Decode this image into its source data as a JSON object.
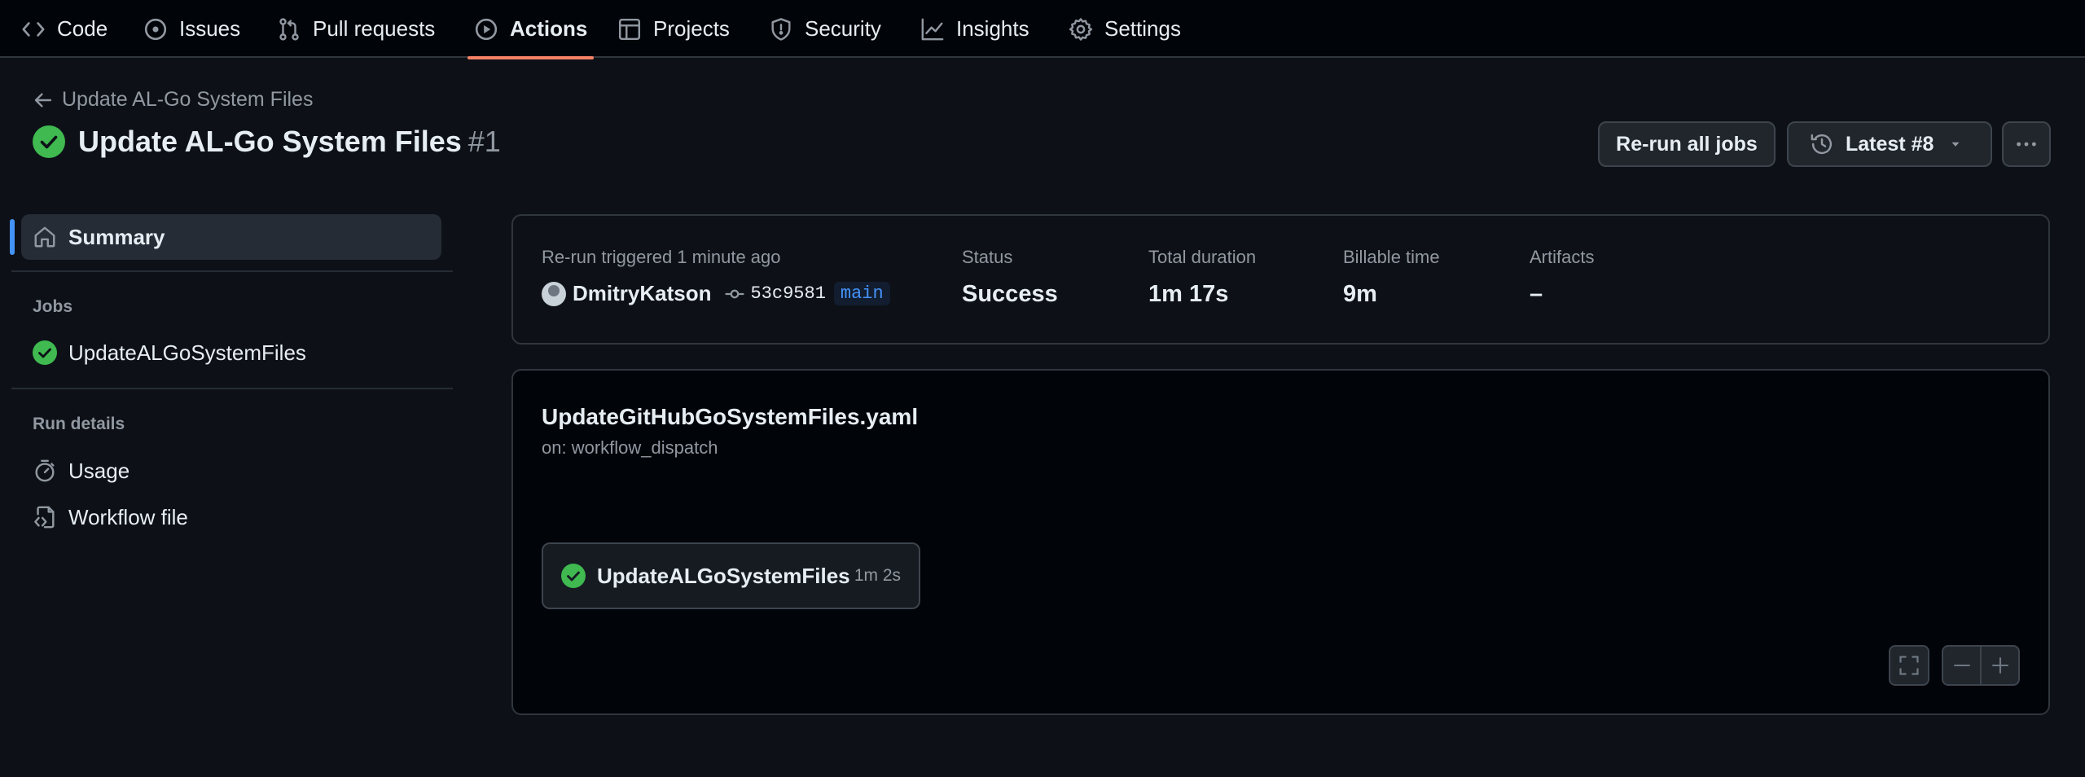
{
  "nav": {
    "tabs": [
      {
        "label": "Code",
        "icon": "code-icon"
      },
      {
        "label": "Issues",
        "icon": "issue-icon"
      },
      {
        "label": "Pull requests",
        "icon": "pull-request-icon"
      },
      {
        "label": "Actions",
        "icon": "play-icon",
        "active": true
      },
      {
        "label": "Projects",
        "icon": "table-icon"
      },
      {
        "label": "Security",
        "icon": "shield-icon"
      },
      {
        "label": "Insights",
        "icon": "graph-icon"
      },
      {
        "label": "Settings",
        "icon": "gear-icon"
      }
    ]
  },
  "header": {
    "breadcrumb": "Update AL-Go System Files",
    "title": "Update AL-Go System Files",
    "run_number": "#1",
    "rerun_button": "Re-run all jobs",
    "latest_button": "Latest #8"
  },
  "sidebar": {
    "summary_label": "Summary",
    "jobs_heading": "Jobs",
    "jobs": [
      {
        "label": "UpdateALGoSystemFiles",
        "status": "success"
      }
    ],
    "run_details_heading": "Run details",
    "usage_label": "Usage",
    "workflow_file_label": "Workflow file"
  },
  "summary": {
    "trigger_label": "Re-run triggered 1 minute ago",
    "actor": "DmitryKatson",
    "commit_sha": "53c9581",
    "branch": "main",
    "status_label": "Status",
    "status_value": "Success",
    "duration_label": "Total duration",
    "duration_value": "1m 17s",
    "billable_label": "Billable time",
    "billable_value": "9m",
    "artifacts_label": "Artifacts",
    "artifacts_value": "–"
  },
  "graph": {
    "workflow_file": "UpdateGitHubGoSystemFiles.yaml",
    "trigger": "on: workflow_dispatch",
    "job": {
      "name": "UpdateALGoSystemFiles",
      "duration": "1m 2s",
      "status": "success"
    }
  },
  "colors": {
    "success": "#3fb950",
    "accent_tab": "#f78166",
    "selection_bar": "#4493f8"
  }
}
